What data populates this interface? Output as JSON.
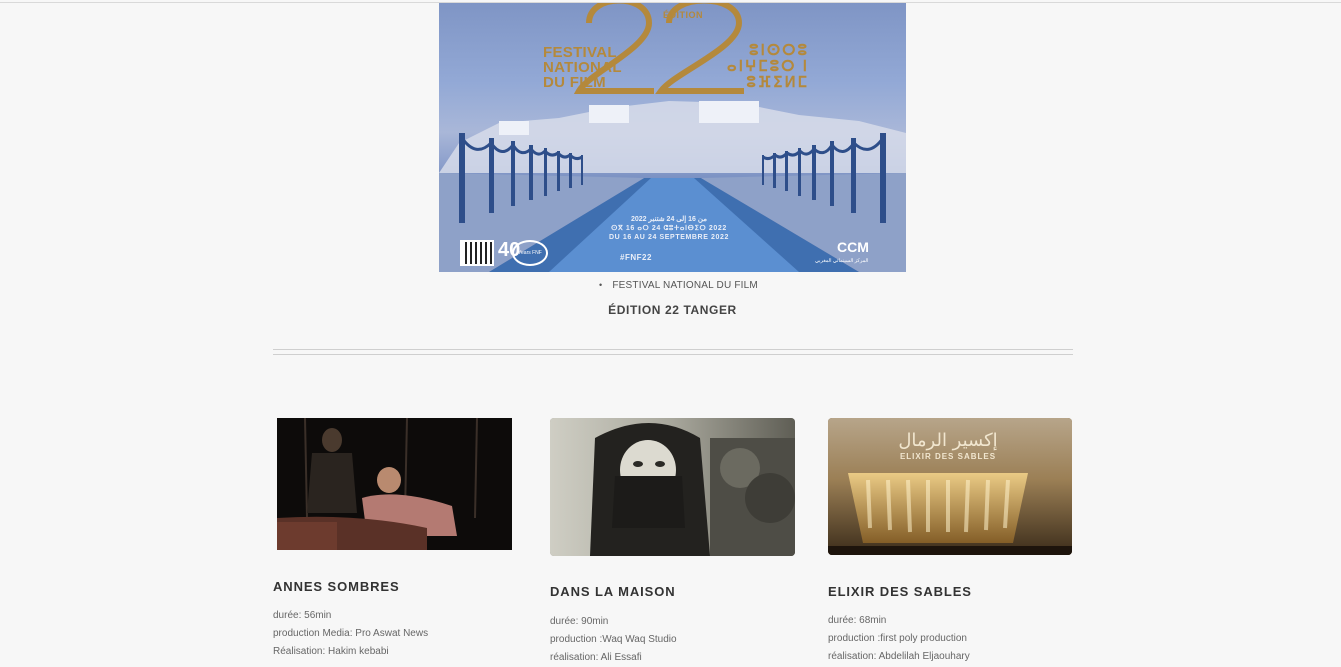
{
  "poster": {
    "lines": [
      "FESTIVAL",
      "NATIONAL",
      "DU FILM"
    ],
    "edition_label": "ÉDITION",
    "tifinagh": "ⵓⵏⵙⵔⵓ ⴰⵏⵖⵎⵓⵔ ⵏ ⵓⴼⵉⵍⵎ",
    "dates_lines": [
      "من 16 إلى 24 شتنبر 2022",
      "ⵙⴳ 16 ⴰⵔ 24 ⵛⵓⵜⴰⵏⴱⵉⵔ 2022",
      "DU 16 AU 24 SEPTEMBRE 2022"
    ],
    "hashtag": "#FNF22",
    "badge_number": "40",
    "badge_caption": "Years FNF",
    "ccm": "CCM",
    "ccm_caption": "المركز السينمائي المغربي"
  },
  "festival": {
    "label": "FESTIVAL NATIONAL DU FILM",
    "edition_title": "ÉDITION 22 TANGER"
  },
  "films": [
    {
      "title": "ANNES SOMBRES",
      "details": [
        "durée: 56min",
        "production Media: Pro Aswat News",
        "Réalisation: Hakim kebabi"
      ]
    },
    {
      "title": "DANS LA MAISON",
      "details": [
        "durée: 90min",
        "production :Waq Waq Studio",
        "réalisation: Ali Essafi"
      ]
    },
    {
      "title": "ELIXIR DES SABLES",
      "details": [
        "durée: 68min",
        "production :first poly production",
        "réalisation: Abdelilah Eljaouhary"
      ]
    }
  ],
  "thumbnails": {
    "film3_overlay_ar": "إكسير الرمال",
    "film3_overlay_fr": "ELIXIR DES SABLES"
  }
}
